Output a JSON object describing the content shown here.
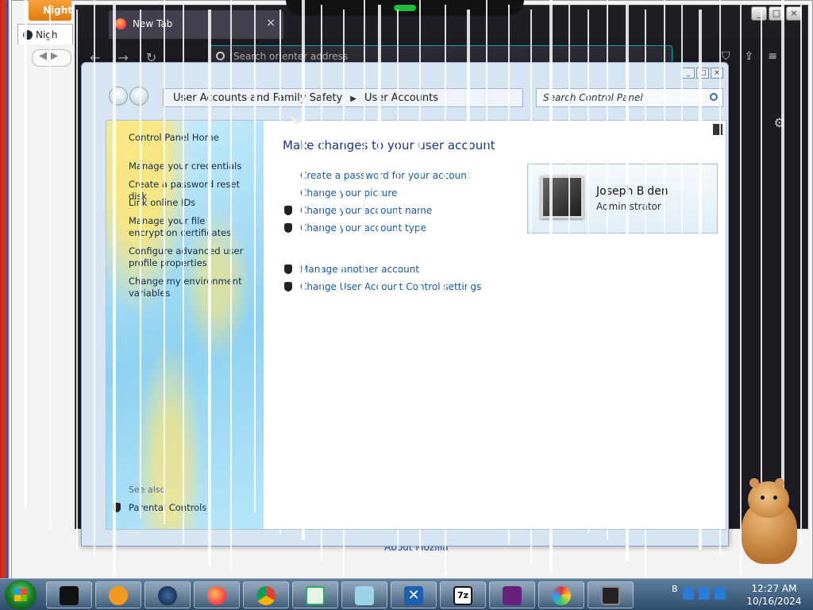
{
  "background_browser": {
    "orange_tab": "Night",
    "tab_label": "Nigh",
    "status_link": "About Mozilla"
  },
  "dark_browser": {
    "tab_title": "New Tab",
    "tab_close": "×",
    "urlbar_placeholder": "Search or enter address"
  },
  "window_controls": [
    "_",
    "□",
    "×"
  ],
  "control_panel": {
    "breadcrumb": [
      "User Accounts and Family Safety",
      "User Accounts"
    ],
    "search_placeholder": "Search Control Panel",
    "sidebar": {
      "home": "Control Panel Home",
      "links": [
        "Manage your credentials",
        "Create a password reset disk",
        "Link online IDs",
        "Manage your file encryption certificates",
        "Configure advanced user profile properties",
        "Change my environment variables"
      ],
      "see_also": "See also",
      "parental_controls": "Parental Controls"
    },
    "heading": "Make changes to your user account",
    "tasks_plain": [
      "Create a password for your account",
      "Change your picture"
    ],
    "tasks_shield": [
      "Change your account name",
      "Change your account type"
    ],
    "tasks_other": [
      "Manage another account",
      "Change User Account Control settings"
    ],
    "user": {
      "name": "Joseph Biden",
      "role": "Administrator"
    }
  },
  "taskbar": {
    "icons": [
      "terminal-icon",
      "media-player-icon",
      "earth-icon",
      "firefox-icon",
      "chrome-icon",
      "notepad-icon",
      "notebook-icon",
      "x-app-icon",
      "7zip-icon",
      "visual-studio-icon",
      "paint-icon",
      "monitor-icon"
    ],
    "tray_text": "B",
    "clock_time": "12:27 AM",
    "clock_date": "10/16/2024"
  }
}
